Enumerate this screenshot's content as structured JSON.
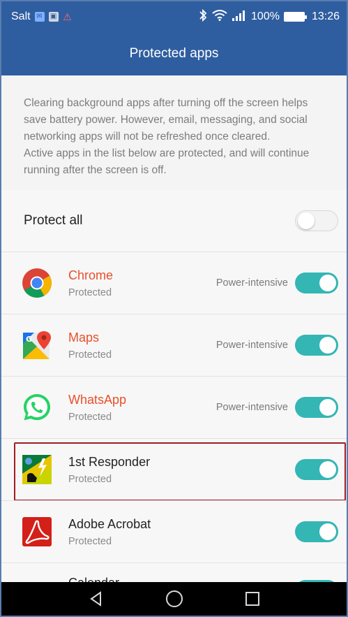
{
  "status_bar": {
    "carrier": "Salt",
    "battery": "100%",
    "time": "13:26"
  },
  "header": {
    "title": "Protected apps"
  },
  "description": {
    "line1": "Clearing background apps after turning off the screen helps save battery power. However, email, messaging, and social networking apps will not be refreshed once cleared.",
    "line2": "Active apps in the list below are protected, and will continue running after the screen is off."
  },
  "protect_all": {
    "label": "Protect all",
    "enabled": false
  },
  "apps": [
    {
      "name": "Chrome",
      "status": "Protected",
      "power_note": "Power-intensive",
      "enabled": true
    },
    {
      "name": "Maps",
      "status": "Protected",
      "power_note": "Power-intensive",
      "enabled": true
    },
    {
      "name": "WhatsApp",
      "status": "Protected",
      "power_note": "Power-intensive",
      "enabled": true
    },
    {
      "name": "1st Responder",
      "status": "Protected",
      "enabled": true
    },
    {
      "name": "Adobe Acrobat",
      "status": "Protected",
      "enabled": true
    },
    {
      "name": "Calendar",
      "enabled": true
    }
  ],
  "colors": {
    "accent": "#33b6b4",
    "header": "#2f5ea0",
    "app_name_highlight": "#e8502b",
    "callout": "#a11c22"
  }
}
